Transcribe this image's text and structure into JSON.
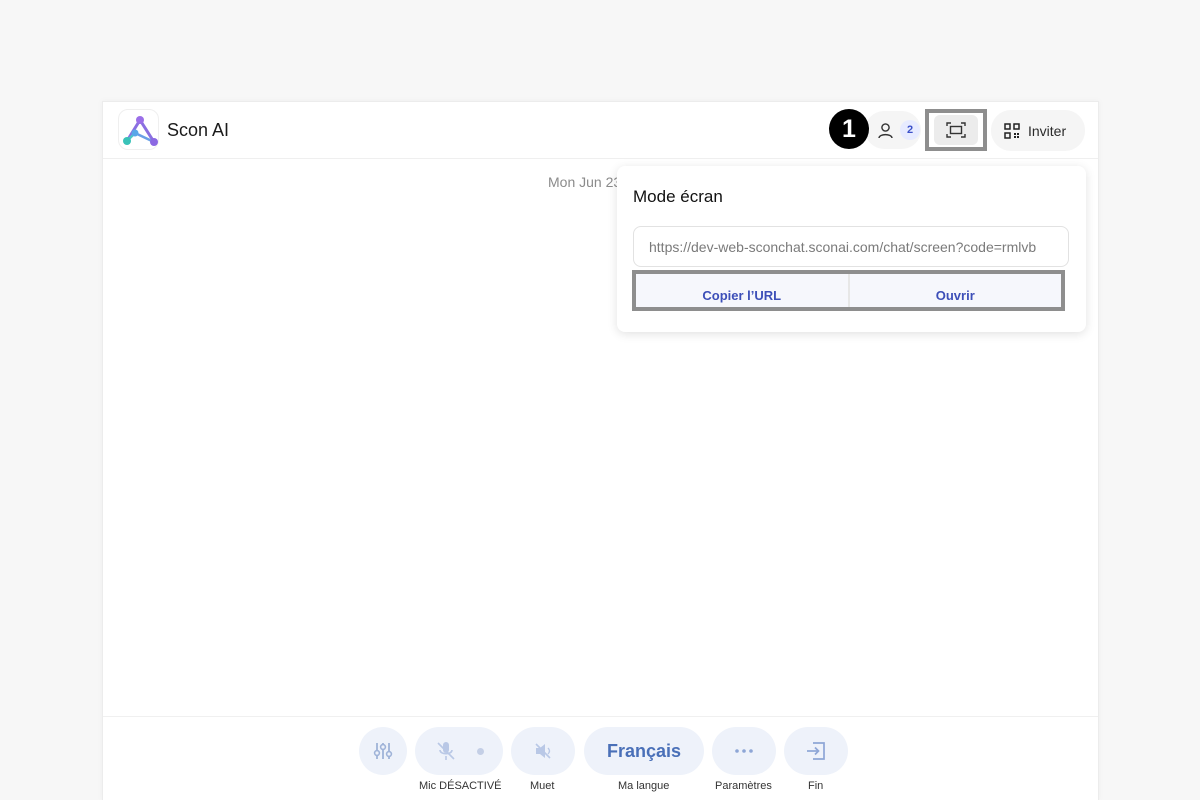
{
  "app": {
    "name": "Scon AI"
  },
  "header": {
    "step_number": "1",
    "participants_count": "2",
    "invite_label": "Inviter"
  },
  "main": {
    "date_text": "Mon Jun 23"
  },
  "popover": {
    "title": "Mode écran",
    "url_value": "https://dev-web-sconchat.sconai.com/chat/screen?code=rmlvb",
    "copy_label": "Copier l’URL",
    "open_label": "Ouvrir"
  },
  "toolbar": {
    "mic_label": "Mic DÉSACTIVÉ",
    "mute_label": "Muet",
    "language_value": "Français",
    "language_label": "Ma langue",
    "settings_label": "Paramètres",
    "end_label": "Fin"
  },
  "colors": {
    "accent": "#3d4fb8",
    "toolbar_button_bg": "#eef2fa",
    "language_text": "#4a70b8",
    "highlight_frame": "#8e8e8e"
  },
  "icons": {
    "logo": "scon-logo-icon",
    "participants": "user-icon",
    "screen_mode": "screen-mode-icon",
    "invite": "qr-code-icon",
    "equalizer": "sliders-icon",
    "mic": "mic-off-icon",
    "mute": "speaker-off-icon",
    "settings": "more-dots-icon",
    "end": "exit-icon"
  }
}
